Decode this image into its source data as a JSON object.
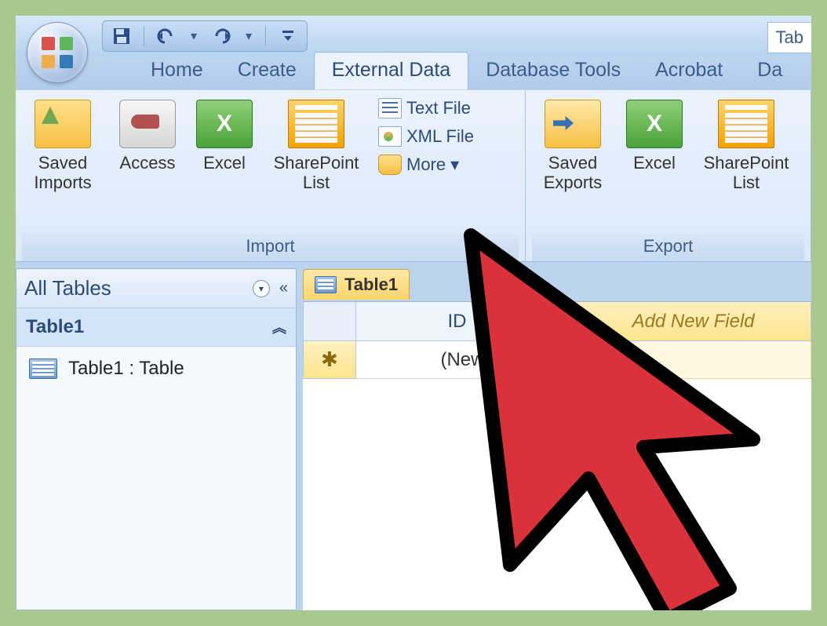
{
  "titlebar": {
    "partial_title": "Tab"
  },
  "ribbon": {
    "tabs": [
      {
        "label": "Home"
      },
      {
        "label": "Create"
      },
      {
        "label": "External Data"
      },
      {
        "label": "Database Tools"
      },
      {
        "label": "Acrobat"
      },
      {
        "label": "Da"
      }
    ],
    "active_tab_index": 2,
    "groups": {
      "import": {
        "label": "Import",
        "buttons": {
          "saved_imports": "Saved\nImports",
          "access": "Access",
          "excel": "Excel",
          "sharepoint": "SharePoint\nList"
        },
        "small": {
          "text_file": "Text File",
          "xml_file": "XML File",
          "more": "More"
        }
      },
      "export": {
        "label": "Export",
        "buttons": {
          "saved_exports": "Saved\nExports",
          "excel": "Excel",
          "sharepoint": "SharePoint\nList"
        }
      }
    }
  },
  "nav": {
    "header": "All Tables",
    "group": "Table1",
    "item": "Table1 : Table"
  },
  "datasheet": {
    "tab": "Table1",
    "columns": {
      "id": "ID",
      "new": "Add New Field"
    },
    "new_row_cell": "(New)"
  }
}
